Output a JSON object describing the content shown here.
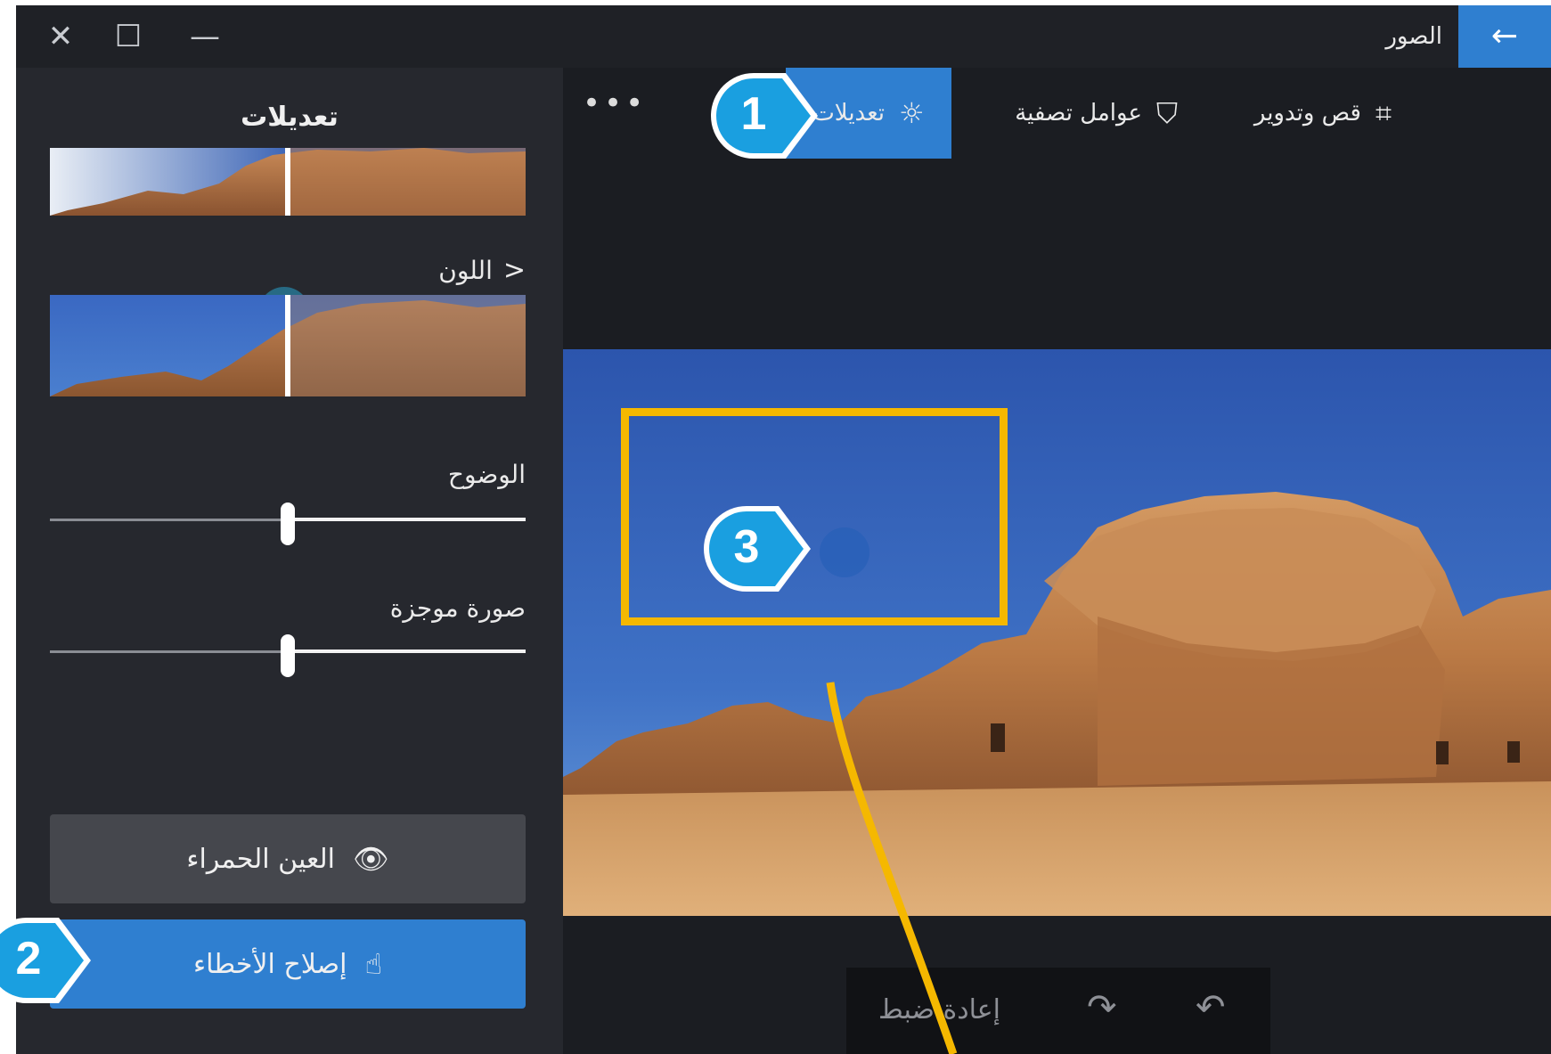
{
  "window": {
    "app_title": "الصور",
    "close_glyph": "✕",
    "maximize_glyph": "☐",
    "minimize_glyph": "—",
    "back_glyph": "←"
  },
  "toolbar": {
    "tabs": [
      {
        "label": "تعديلات",
        "icon": "sun-icon",
        "active": true
      },
      {
        "label": "عوامل تصفية",
        "icon": "filter-brush-icon"
      },
      {
        "label": "قص وتدوير",
        "icon": "crop-icon"
      }
    ],
    "more_glyph": "•••"
  },
  "panel": {
    "title": "تعديلات",
    "color_label": "اللون",
    "sliders": [
      {
        "label": "الوضوح",
        "value": 0.5
      },
      {
        "label": "صورة موجزة",
        "value": 0.5
      }
    ],
    "red_eye_label": "العين الحمراء",
    "spot_fix_label": "إصلاح الأخطاء",
    "light_preview_split": 0.5,
    "color_preview_split": 0.5
  },
  "bottom_bar": {
    "reset_label": "إعادة ضبط"
  },
  "callouts": [
    "1",
    "2",
    "3"
  ],
  "colors": {
    "accent": "#2f7fd0",
    "callout": "#1a9fe0",
    "highlight": "#f5b800"
  }
}
